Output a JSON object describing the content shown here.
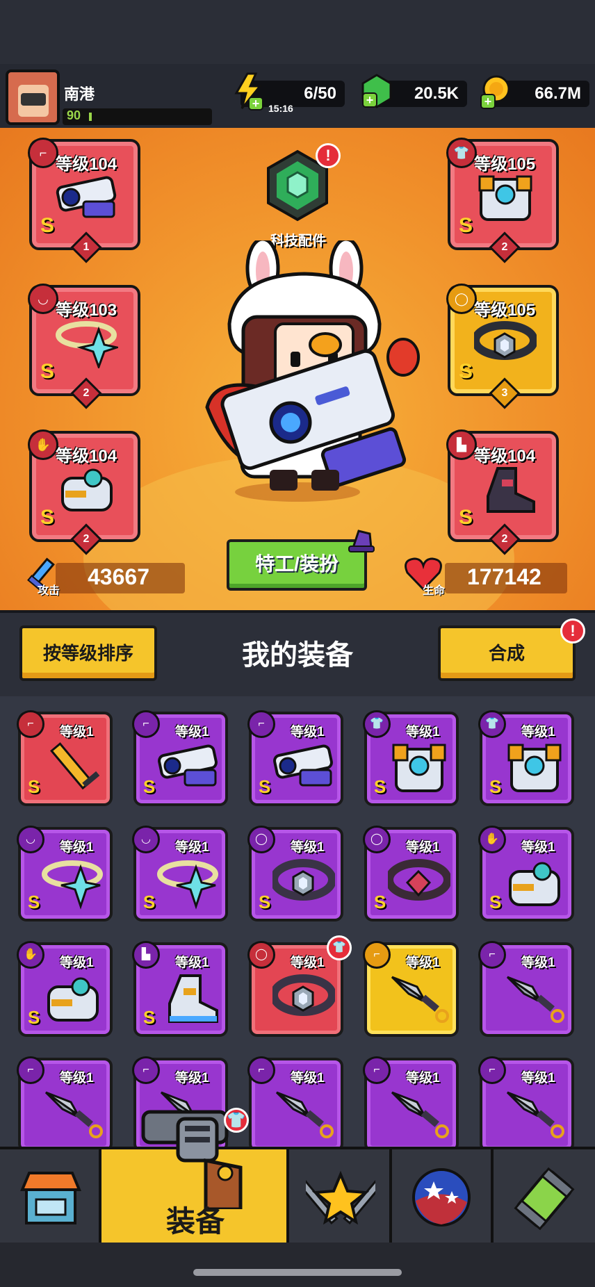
{
  "player": {
    "name": "南港",
    "level": "90"
  },
  "resources": {
    "energy": {
      "value": "6/50",
      "timer": "15:16",
      "icon": "lightning-plus-icon"
    },
    "gems": {
      "value": "20.5K",
      "icon": "green-gem-plus-icon"
    },
    "coins": {
      "value": "66.7M",
      "icon": "gold-coin-plus-icon"
    }
  },
  "tech": {
    "label": "科技配件",
    "alert": "!"
  },
  "slots": [
    {
      "label": "等级104",
      "grade": "S",
      "stars": "1",
      "type": "weapon"
    },
    {
      "label": "等级103",
      "grade": "S",
      "stars": "2",
      "type": "necklace"
    },
    {
      "label": "等级104",
      "grade": "S",
      "stars": "2",
      "type": "gloves"
    },
    {
      "label": "等级105",
      "grade": "S",
      "stars": "2",
      "type": "armor"
    },
    {
      "label": "等级105",
      "grade": "S",
      "stars": "3",
      "type": "belt"
    },
    {
      "label": "等级104",
      "grade": "S",
      "stars": "2",
      "type": "boots"
    }
  ],
  "stats": {
    "attack_label": "攻击",
    "attack": "43667",
    "hp_label": "生命",
    "hp": "177142"
  },
  "agent_button": "特工/装扮",
  "inventory_header": {
    "sort_button": "按等级排序",
    "title": "我的装备",
    "merge_button": "合成",
    "merge_alert": "!"
  },
  "inventory": [
    {
      "label": "等级1",
      "grade": "S",
      "color": "red",
      "item": "sword"
    },
    {
      "label": "等级1",
      "grade": "S",
      "color": "purple",
      "item": "blaster"
    },
    {
      "label": "等级1",
      "grade": "S",
      "color": "purple",
      "item": "blaster"
    },
    {
      "label": "等级1",
      "grade": "S",
      "color": "purple",
      "item": "armor"
    },
    {
      "label": "等级1",
      "grade": "S",
      "color": "purple",
      "item": "armor"
    },
    {
      "label": "等级1",
      "grade": "S",
      "color": "purple",
      "item": "necklace"
    },
    {
      "label": "等级1",
      "grade": "S",
      "color": "purple",
      "item": "necklace"
    },
    {
      "label": "等级1",
      "grade": "S",
      "color": "purple",
      "item": "belt"
    },
    {
      "label": "等级1",
      "grade": "S",
      "color": "purple",
      "item": "belt-ruby"
    },
    {
      "label": "等级1",
      "grade": "S",
      "color": "purple",
      "item": "gloves"
    },
    {
      "label": "等级1",
      "grade": "S",
      "color": "purple",
      "item": "gloves"
    },
    {
      "label": "等级1",
      "grade": "S",
      "color": "purple",
      "item": "boots"
    },
    {
      "label": "等级1",
      "grade": "",
      "color": "red",
      "item": "belt"
    },
    {
      "label": "等级1",
      "grade": "",
      "color": "yellow",
      "item": "kunai"
    },
    {
      "label": "等级1",
      "grade": "",
      "color": "purple",
      "item": "kunai"
    },
    {
      "label": "等级1",
      "grade": "",
      "color": "purple",
      "item": "kunai"
    },
    {
      "label": "等级1",
      "grade": "",
      "color": "purple",
      "item": "kunai"
    },
    {
      "label": "等级1",
      "grade": "",
      "color": "purple",
      "item": "kunai"
    },
    {
      "label": "等级1",
      "grade": "",
      "color": "purple",
      "item": "kunai"
    },
    {
      "label": "等级1",
      "grade": "",
      "color": "purple",
      "item": "kunai"
    }
  ],
  "nav": [
    {
      "label": "",
      "icon": "shop-icon"
    },
    {
      "label": "装备",
      "icon": "revolver-icon",
      "active": true
    },
    {
      "label": "",
      "icon": "star-swords-icon"
    },
    {
      "label": "",
      "icon": "planet-icon"
    },
    {
      "label": "",
      "icon": "dna-capsule-icon"
    }
  ],
  "colors": {
    "orange_bg": "#f08f2a",
    "purple_card": "#9836cf",
    "red_card": "#e34653",
    "yellow_btn": "#f5c52b",
    "green_btn": "#77d13e"
  }
}
